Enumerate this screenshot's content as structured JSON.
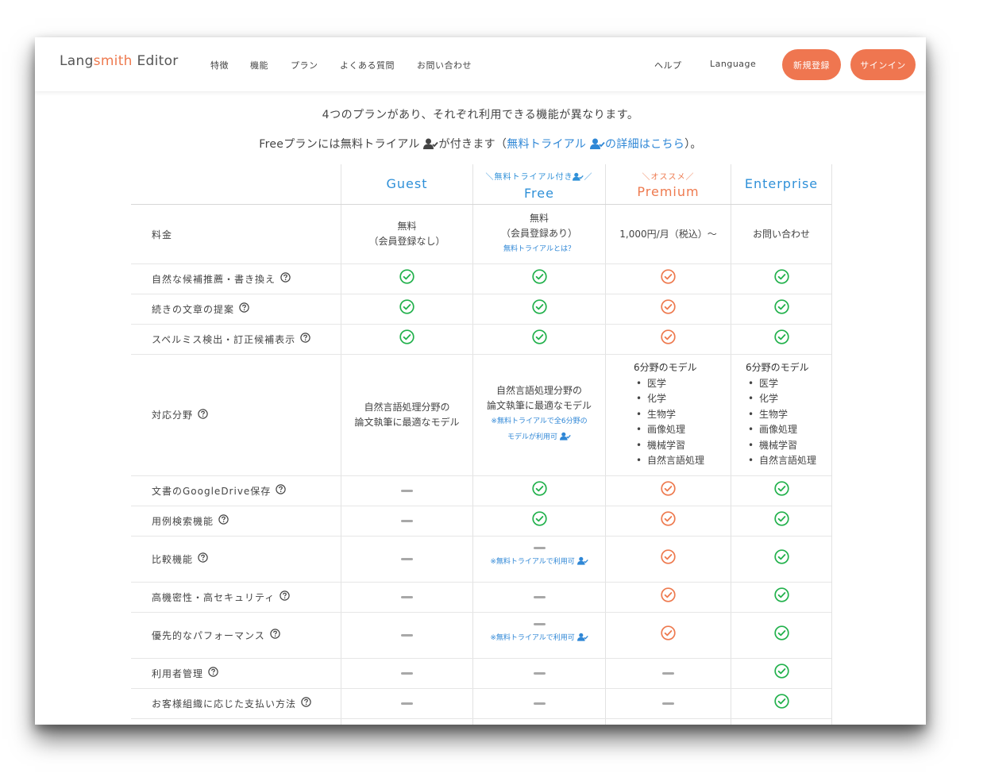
{
  "header": {
    "logo_prefix": "Lang",
    "logo_accent": "smith",
    "logo_suffix": " Editor",
    "nav": [
      "特徴",
      "機能",
      "プラン",
      "よくある質問",
      "お問い合わせ"
    ],
    "help": "ヘルプ",
    "language": "Language",
    "signup": "新規登録",
    "signin": "サインイン"
  },
  "intro": {
    "line1": "4つのプランがあり、それぞれ利用できる機能が異なります。",
    "line2_a": "Freeプランには無料トライアル",
    "line2_b": "が付きます（",
    "line2_link_a": "無料トライアル",
    "line2_link_b": "の詳細はこちら",
    "line2_c": "）。"
  },
  "plans": [
    {
      "tag": "",
      "name": "Guest"
    },
    {
      "tag": "＼無料トライアル付き",
      "tag_end": "／",
      "name": "Free"
    },
    {
      "tag": "＼オススメ／",
      "name": "Premium"
    },
    {
      "tag": "",
      "name": "Enterprise"
    }
  ],
  "pricing": {
    "label": "料金",
    "guest": [
      "無料",
      "（会員登録なし）"
    ],
    "free": [
      "無料",
      "（会員登録あり）"
    ],
    "free_note": "無料トライアルとは？",
    "premium": "1,000円/月（税込）〜",
    "enterprise": "お問い合わせ"
  },
  "feature_rows": [
    {
      "label": "自然な候補推薦・書き換え",
      "values": [
        "check",
        "check",
        "check",
        "check"
      ]
    },
    {
      "label": "続きの文章の提案",
      "values": [
        "check",
        "check",
        "check",
        "check"
      ]
    },
    {
      "label": "スペルミス検出・訂正候補表示",
      "values": [
        "check",
        "check",
        "check",
        "check"
      ]
    }
  ],
  "fields_row": {
    "label": "対応分野",
    "guest": [
      "自然言語処理分野の",
      "論文執筆に最適なモデル"
    ],
    "free": [
      "自然言語処理分野の",
      "論文執筆に最適なモデル"
    ],
    "free_note": [
      "※無料トライアルで全6分野の",
      "モデルが利用可"
    ],
    "model_title": "6分野のモデル",
    "fields": [
      "医学",
      "化学",
      "生物学",
      "画像処理",
      "機械学習",
      "自然言語処理"
    ]
  },
  "lower_rows": [
    {
      "label": "文書のGoogleDrive保存",
      "values": [
        "dash",
        "check",
        "check",
        "check"
      ],
      "note": ""
    },
    {
      "label": "用例検索機能",
      "values": [
        "dash",
        "check",
        "check",
        "check"
      ],
      "note": ""
    },
    {
      "label": "比較機能",
      "values": [
        "dash",
        "dash",
        "check",
        "check"
      ],
      "note": "※無料トライアルで利用可"
    },
    {
      "label": "高機密性・高セキュリティ",
      "values": [
        "dash",
        "dash",
        "check",
        "check"
      ],
      "note": ""
    },
    {
      "label": "優先的なパフォーマンス",
      "values": [
        "dash",
        "dash",
        "check",
        "check"
      ],
      "note": "※無料トライアルで利用可"
    },
    {
      "label": "利用者管理",
      "values": [
        "dash",
        "dash",
        "dash",
        "check"
      ],
      "note": ""
    },
    {
      "label": "お客様組織に応じた支払い方法",
      "values": [
        "dash",
        "dash",
        "dash",
        "check"
      ],
      "note": ""
    }
  ],
  "colors": {
    "accent_orange": "#ee7a4f",
    "check_green": "#22b14c",
    "link_blue": "#2f87d6",
    "heading_blue": "#2f90d8"
  }
}
